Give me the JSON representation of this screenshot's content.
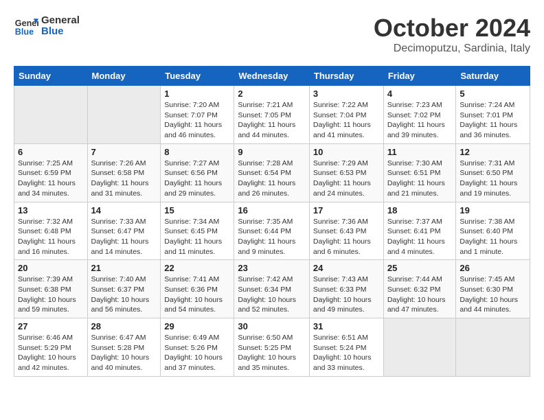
{
  "header": {
    "logo_line1": "General",
    "logo_line2": "Blue",
    "month": "October 2024",
    "location": "Decimoputzu, Sardinia, Italy"
  },
  "weekdays": [
    "Sunday",
    "Monday",
    "Tuesday",
    "Wednesday",
    "Thursday",
    "Friday",
    "Saturday"
  ],
  "weeks": [
    [
      null,
      null,
      {
        "day": "1",
        "sunrise": "Sunrise: 7:20 AM",
        "sunset": "Sunset: 7:07 PM",
        "daylight": "Daylight: 11 hours and 46 minutes."
      },
      {
        "day": "2",
        "sunrise": "Sunrise: 7:21 AM",
        "sunset": "Sunset: 7:05 PM",
        "daylight": "Daylight: 11 hours and 44 minutes."
      },
      {
        "day": "3",
        "sunrise": "Sunrise: 7:22 AM",
        "sunset": "Sunset: 7:04 PM",
        "daylight": "Daylight: 11 hours and 41 minutes."
      },
      {
        "day": "4",
        "sunrise": "Sunrise: 7:23 AM",
        "sunset": "Sunset: 7:02 PM",
        "daylight": "Daylight: 11 hours and 39 minutes."
      },
      {
        "day": "5",
        "sunrise": "Sunrise: 7:24 AM",
        "sunset": "Sunset: 7:01 PM",
        "daylight": "Daylight: 11 hours and 36 minutes."
      }
    ],
    [
      {
        "day": "6",
        "sunrise": "Sunrise: 7:25 AM",
        "sunset": "Sunset: 6:59 PM",
        "daylight": "Daylight: 11 hours and 34 minutes."
      },
      {
        "day": "7",
        "sunrise": "Sunrise: 7:26 AM",
        "sunset": "Sunset: 6:58 PM",
        "daylight": "Daylight: 11 hours and 31 minutes."
      },
      {
        "day": "8",
        "sunrise": "Sunrise: 7:27 AM",
        "sunset": "Sunset: 6:56 PM",
        "daylight": "Daylight: 11 hours and 29 minutes."
      },
      {
        "day": "9",
        "sunrise": "Sunrise: 7:28 AM",
        "sunset": "Sunset: 6:54 PM",
        "daylight": "Daylight: 11 hours and 26 minutes."
      },
      {
        "day": "10",
        "sunrise": "Sunrise: 7:29 AM",
        "sunset": "Sunset: 6:53 PM",
        "daylight": "Daylight: 11 hours and 24 minutes."
      },
      {
        "day": "11",
        "sunrise": "Sunrise: 7:30 AM",
        "sunset": "Sunset: 6:51 PM",
        "daylight": "Daylight: 11 hours and 21 minutes."
      },
      {
        "day": "12",
        "sunrise": "Sunrise: 7:31 AM",
        "sunset": "Sunset: 6:50 PM",
        "daylight": "Daylight: 11 hours and 19 minutes."
      }
    ],
    [
      {
        "day": "13",
        "sunrise": "Sunrise: 7:32 AM",
        "sunset": "Sunset: 6:48 PM",
        "daylight": "Daylight: 11 hours and 16 minutes."
      },
      {
        "day": "14",
        "sunrise": "Sunrise: 7:33 AM",
        "sunset": "Sunset: 6:47 PM",
        "daylight": "Daylight: 11 hours and 14 minutes."
      },
      {
        "day": "15",
        "sunrise": "Sunrise: 7:34 AM",
        "sunset": "Sunset: 6:45 PM",
        "daylight": "Daylight: 11 hours and 11 minutes."
      },
      {
        "day": "16",
        "sunrise": "Sunrise: 7:35 AM",
        "sunset": "Sunset: 6:44 PM",
        "daylight": "Daylight: 11 hours and 9 minutes."
      },
      {
        "day": "17",
        "sunrise": "Sunrise: 7:36 AM",
        "sunset": "Sunset: 6:43 PM",
        "daylight": "Daylight: 11 hours and 6 minutes."
      },
      {
        "day": "18",
        "sunrise": "Sunrise: 7:37 AM",
        "sunset": "Sunset: 6:41 PM",
        "daylight": "Daylight: 11 hours and 4 minutes."
      },
      {
        "day": "19",
        "sunrise": "Sunrise: 7:38 AM",
        "sunset": "Sunset: 6:40 PM",
        "daylight": "Daylight: 11 hours and 1 minute."
      }
    ],
    [
      {
        "day": "20",
        "sunrise": "Sunrise: 7:39 AM",
        "sunset": "Sunset: 6:38 PM",
        "daylight": "Daylight: 10 hours and 59 minutes."
      },
      {
        "day": "21",
        "sunrise": "Sunrise: 7:40 AM",
        "sunset": "Sunset: 6:37 PM",
        "daylight": "Daylight: 10 hours and 56 minutes."
      },
      {
        "day": "22",
        "sunrise": "Sunrise: 7:41 AM",
        "sunset": "Sunset: 6:36 PM",
        "daylight": "Daylight: 10 hours and 54 minutes."
      },
      {
        "day": "23",
        "sunrise": "Sunrise: 7:42 AM",
        "sunset": "Sunset: 6:34 PM",
        "daylight": "Daylight: 10 hours and 52 minutes."
      },
      {
        "day": "24",
        "sunrise": "Sunrise: 7:43 AM",
        "sunset": "Sunset: 6:33 PM",
        "daylight": "Daylight: 10 hours and 49 minutes."
      },
      {
        "day": "25",
        "sunrise": "Sunrise: 7:44 AM",
        "sunset": "Sunset: 6:32 PM",
        "daylight": "Daylight: 10 hours and 47 minutes."
      },
      {
        "day": "26",
        "sunrise": "Sunrise: 7:45 AM",
        "sunset": "Sunset: 6:30 PM",
        "daylight": "Daylight: 10 hours and 44 minutes."
      }
    ],
    [
      {
        "day": "27",
        "sunrise": "Sunrise: 6:46 AM",
        "sunset": "Sunset: 5:29 PM",
        "daylight": "Daylight: 10 hours and 42 minutes."
      },
      {
        "day": "28",
        "sunrise": "Sunrise: 6:47 AM",
        "sunset": "Sunset: 5:28 PM",
        "daylight": "Daylight: 10 hours and 40 minutes."
      },
      {
        "day": "29",
        "sunrise": "Sunrise: 6:49 AM",
        "sunset": "Sunset: 5:26 PM",
        "daylight": "Daylight: 10 hours and 37 minutes."
      },
      {
        "day": "30",
        "sunrise": "Sunrise: 6:50 AM",
        "sunset": "Sunset: 5:25 PM",
        "daylight": "Daylight: 10 hours and 35 minutes."
      },
      {
        "day": "31",
        "sunrise": "Sunrise: 6:51 AM",
        "sunset": "Sunset: 5:24 PM",
        "daylight": "Daylight: 10 hours and 33 minutes."
      },
      null,
      null
    ]
  ]
}
